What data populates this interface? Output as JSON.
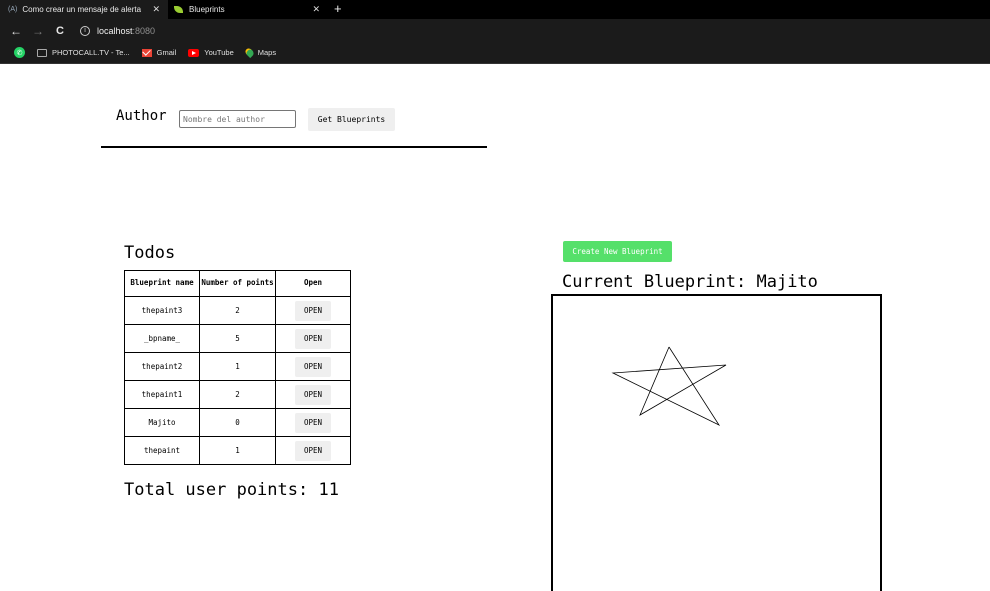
{
  "browser": {
    "tabs": [
      {
        "favicon": "(A)",
        "title": "Como crear un mensaje de alerta",
        "close": "✕"
      },
      {
        "favicon": "leaf-icon",
        "title": "Blueprints",
        "close": "✕"
      }
    ],
    "new_tab": "+",
    "url_host": "localhost",
    "url_port": ":8080",
    "bookmarks": [
      {
        "icon": "folder-icon",
        "label": "PHOTOCALL.TV - Te..."
      },
      {
        "icon": "gmail-icon",
        "label": "Gmail"
      },
      {
        "icon": "youtube-icon",
        "label": "YouTube"
      },
      {
        "icon": "maps-icon",
        "label": "Maps"
      }
    ]
  },
  "author": {
    "label": "Author",
    "placeholder": "Nombre del author",
    "value": "",
    "button_label": "Get Blueprints"
  },
  "blueprints": {
    "title": "Todos",
    "headers": [
      "Blueprint name",
      "Number of points",
      "Open"
    ],
    "rows": [
      {
        "name": "thepaint3",
        "points": "2",
        "action": "OPEN"
      },
      {
        "name": "_bpname_",
        "points": "5",
        "action": "OPEN"
      },
      {
        "name": "thepaint2",
        "points": "1",
        "action": "OPEN"
      },
      {
        "name": "thepaint1",
        "points": "2",
        "action": "OPEN"
      },
      {
        "name": "Majito",
        "points": "0",
        "action": "OPEN"
      },
      {
        "name": "thepaint",
        "points": "1",
        "action": "OPEN"
      }
    ],
    "total": "Total user points: 11"
  },
  "editor": {
    "create_label": "Create New Blueprint",
    "current_prefix": "Current Blueprint:",
    "current_name": "Majito",
    "stroke_color": "#000000"
  }
}
